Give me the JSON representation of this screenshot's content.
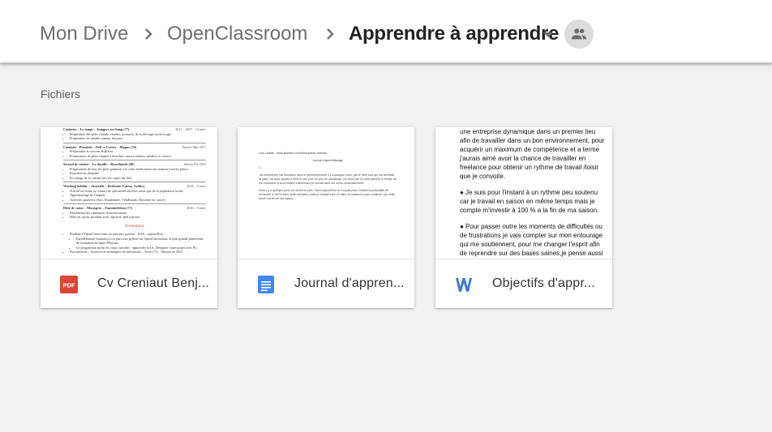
{
  "breadcrumb": {
    "items": [
      {
        "label": "Mon Drive"
      },
      {
        "label": "OpenClassroom"
      },
      {
        "label": "Apprendre à apprendre"
      }
    ]
  },
  "section": {
    "title": "Fichiers"
  },
  "files": [
    {
      "name": "Cv Creniaut Benj...",
      "icon": "pdf-icon",
      "icon_label": "PDF",
      "icon_color": "#db4437",
      "preview": {
        "entries": [
          {
            "title": "Cuisinier – Le temps – Songpyo sur hang (77)",
            "date": "2015 – 2017 · 13 mois",
            "bullets": [
              "Préparation des plats chauds, viandes, poissons, de la découpe au dressage",
              "Préparation de salades, pizzas, desserts"
            ]
          },
          {
            "title": "Cuisinier / Pizzaiolo – Deli 'a Corner – Magny (76)",
            "date": "Janvier-Mai 2017",
            "bullets": [
              "Préparation et cuisson de pizzas",
              "Préparations de plats simples ( brioches, sauces maison, salades) et service"
            ]
          },
          {
            "title": "Second de cuisine – La dusolle – Brocéliande (48)",
            "date": "Saison Été 2016",
            "bullets": [
              "Préparations de tous les plats garnison à la carte entièrement fait maison (sauces, plats)",
              "Entretien du domaine",
              "En charge de la cuisine lors des repos du chef"
            ]
          },
          {
            "title": "Working holiday – Australie – Brisbane, Cairns, Sydney.",
            "date": "2014 – 9 mois",
            "bullets": [
              "Travail en ferme au contact de spécialités diverses aussi que de la population locale.",
              "Apprentissage de l'anglais.",
              "Activités sportives (Surf, Randonnée, VéloRando, Descente en canoë)"
            ]
          },
          {
            "title": "Hôte de caisse – Monoprix – Fontainebleau (77)",
            "date": "2010 – 9 mois",
            "bullets": [
              "Réalisation des opérations d'encaissement",
              "Mise en rayon, produits frais, épicerie, prêt à porter."
            ]
          }
        ],
        "section_label": "Formations",
        "formations": [
          "Étudiant d'OpenClassrooms au parcours python · 2018 – aujourd'hui.",
          "Parallèlement formation à ce parcours python sur OpenClassrooms, la plus grande plateforme de formation en ligne d'Europe",
          "Le programme inclut les cours suivants : apprendre la IA, Démarrer votre projet avec Py.",
          "Baccalauréat – Sciences et techniques du laboratoire – Avon (77) · Obtenu en 2012"
        ]
      }
    },
    {
      "name": "Journal d'appren...",
      "icon": "google-docs-icon",
      "icon_color": "#4285f4",
      "preview": {
        "link": "Lien Linkdin : www.linkedin.com/in/benjamin-creniaut",
        "heading": "Journal d'apprentissage",
        "marker": "1 –",
        "paragraphs": [
          "J'ai commencé ma formation dans le développement il y a quelque mois, par le front end qui me semblait la base, j'ai donc appris le html et css, puis un peu de Javascript, j'ai voulu par la suite prendre le temps de me consacrer à la formation entièrement je suivait dans les cours ponctuellement.",
          "Voilà il y a quelque jours j'ai ouvert le parc, étant aujourd'hui ce n'ai pas pour l'instant la possibilité de m'investir à 100% dans cette formation mais je compte bien en faire un maximum puis continuer par cette lancé a la fin de ma saison."
        ]
      }
    },
    {
      "name": "Objectifs d'appr...",
      "icon": "word-icon",
      "icon_color": "#3f78d6",
      "preview": {
        "paragraphs": [
          "une entreprise dynamique dans un premier lieu afin de travailler dans un bon environnement, pour acquérir un maximum de compétence et a terme j'aurais aimé avoir la chance de travailler en freelance pour obtenir un rythme de travail /loisir que je convoite.",
          "●  Je suis pour l'instant à un rythme peu soutenu car je travail en saison en même temps mais je compte m'investir à 100 % a la fin de ma saison.",
          "●  Pour passer outre les moments de difficultés ou de frustrations je vais compter sur mon entourage qui me soutiennent, pour me changer l'esprit afin de reprendre sur des bases saines,je pense aussi interrompre la formation par des"
        ]
      }
    }
  ]
}
